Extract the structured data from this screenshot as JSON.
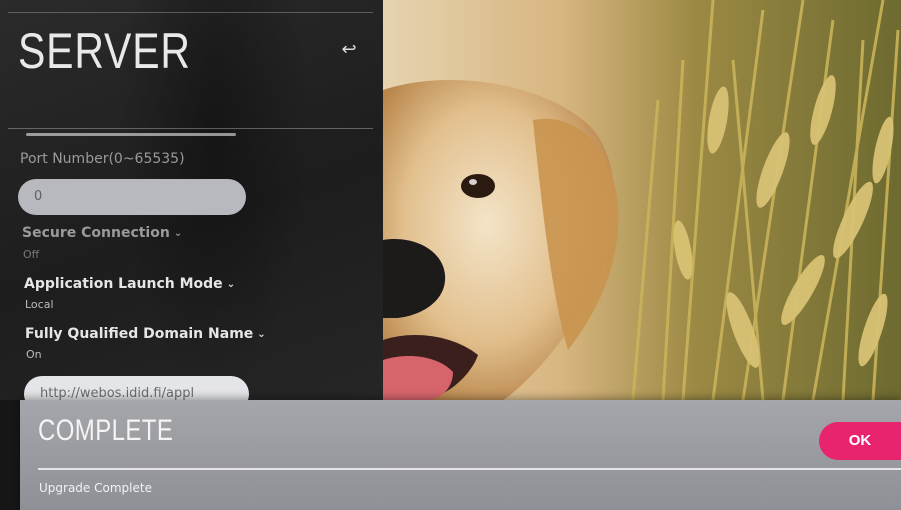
{
  "panel": {
    "title": "SERVER",
    "back_icon": "back-arrow-icon",
    "port_label": "Port Number(0~65535)",
    "port_value": "0",
    "secure_connection": {
      "label": "Secure Connection",
      "value": "Off"
    },
    "launch_mode": {
      "label": "Application Launch Mode",
      "value": "Local"
    },
    "fqdn": {
      "label": "Fully Qualified Domain Name",
      "value": "On"
    },
    "url_value": "http://webos.idid.fi/appl"
  },
  "popup": {
    "title": "COMPLETE",
    "message": "Upgrade Complete",
    "ok_label": "OK"
  },
  "colors": {
    "accent": "#e8246f",
    "popup_bg": "#9c9da2",
    "field_bg": "#b7b9be"
  }
}
